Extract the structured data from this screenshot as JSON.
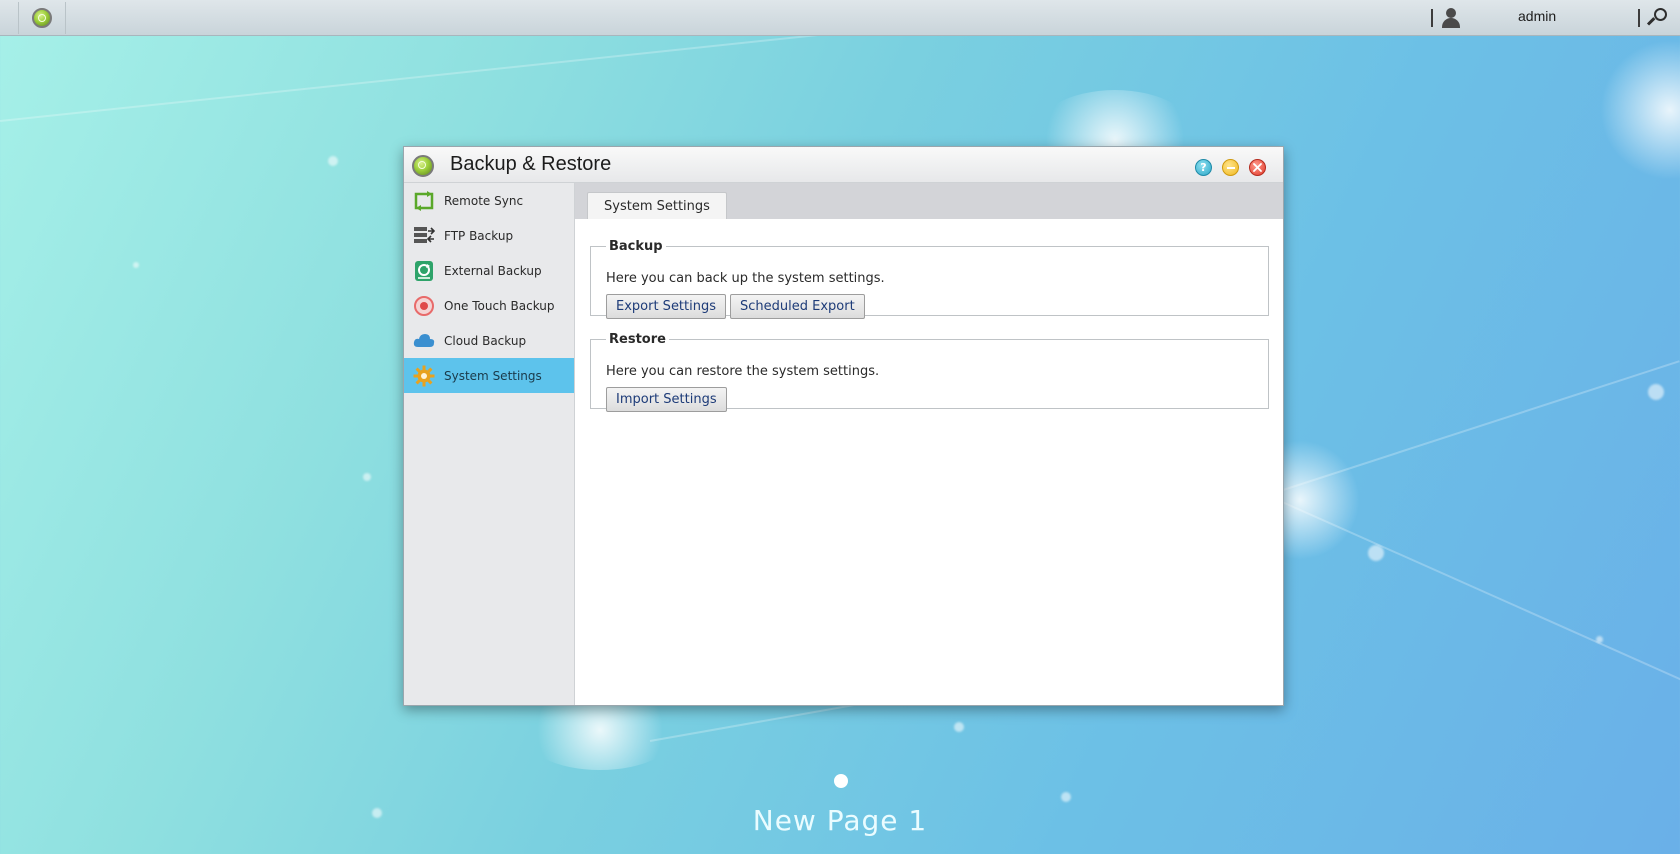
{
  "topbar": {
    "user_name": "admin"
  },
  "window": {
    "title": "Backup & Restore",
    "help_symbol": "?"
  },
  "sidebar": {
    "items": [
      {
        "label": "Remote Sync",
        "icon": "remote-sync-icon"
      },
      {
        "label": "FTP Backup",
        "icon": "ftp-backup-icon"
      },
      {
        "label": "External Backup",
        "icon": "external-backup-icon"
      },
      {
        "label": "One Touch Backup",
        "icon": "one-touch-backup-icon"
      },
      {
        "label": "Cloud Backup",
        "icon": "cloud-icon"
      },
      {
        "label": "System Settings",
        "icon": "gear-icon",
        "active": true
      }
    ]
  },
  "main": {
    "tab": "System Settings",
    "backup": {
      "legend": "Backup",
      "description": "Here you can back up the system settings.",
      "export_button": "Export Settings",
      "scheduled_button": "Scheduled Export"
    },
    "restore": {
      "legend": "Restore",
      "description": "Here you can restore the system settings.",
      "import_button": "Import Settings"
    }
  },
  "desktop": {
    "page_label": "New Page 1"
  },
  "colors": {
    "active_nav": "#5dc3ec",
    "button_text": "#1d3b78"
  }
}
